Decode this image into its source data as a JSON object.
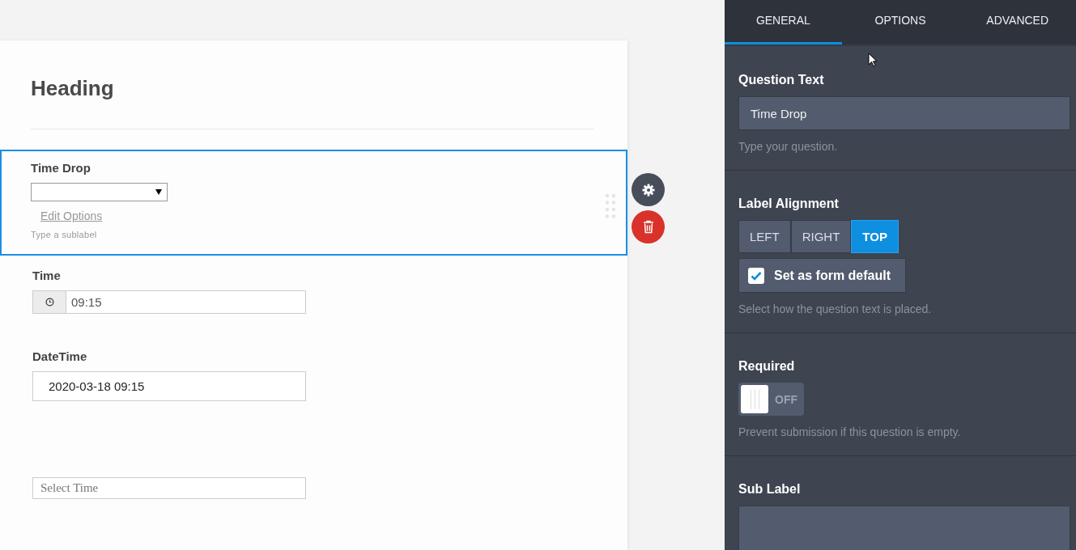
{
  "form": {
    "heading": "Heading",
    "fields": [
      {
        "kind": "dropdown",
        "label": "Time Drop",
        "selected": true,
        "link": "Edit Options",
        "sublabel": "Type a sublabel"
      },
      {
        "kind": "time",
        "label": "Time",
        "selected": false,
        "value": "09:15"
      },
      {
        "kind": "text",
        "label": "DateTime",
        "selected": false,
        "value": "2020-03-18 09:15"
      },
      {
        "kind": "text",
        "selected": false,
        "placeholder": "Select Time"
      }
    ]
  },
  "panel": {
    "tabs": [
      {
        "label": "GENERAL",
        "selected": true
      },
      {
        "label": "OPTIONS",
        "selected": false
      },
      {
        "label": "ADVANCED",
        "selected": false
      }
    ],
    "question_text": {
      "label": "Question Text",
      "value": "Time Drop",
      "hint": "Type your question."
    },
    "label_alignment": {
      "label": "Label Alignment",
      "options": [
        {
          "label": "LEFT",
          "selected": false
        },
        {
          "label": "RIGHT",
          "selected": false
        },
        {
          "label": "TOP",
          "selected": true
        }
      ],
      "default_checkbox": {
        "label": "Set as form default",
        "checked": true
      },
      "hint": "Select how the question text is placed."
    },
    "required": {
      "label": "Required",
      "on": false,
      "state_text": "OFF",
      "hint": "Prevent submission if this question is empty."
    },
    "sub_label": {
      "label": "Sub Label"
    }
  }
}
